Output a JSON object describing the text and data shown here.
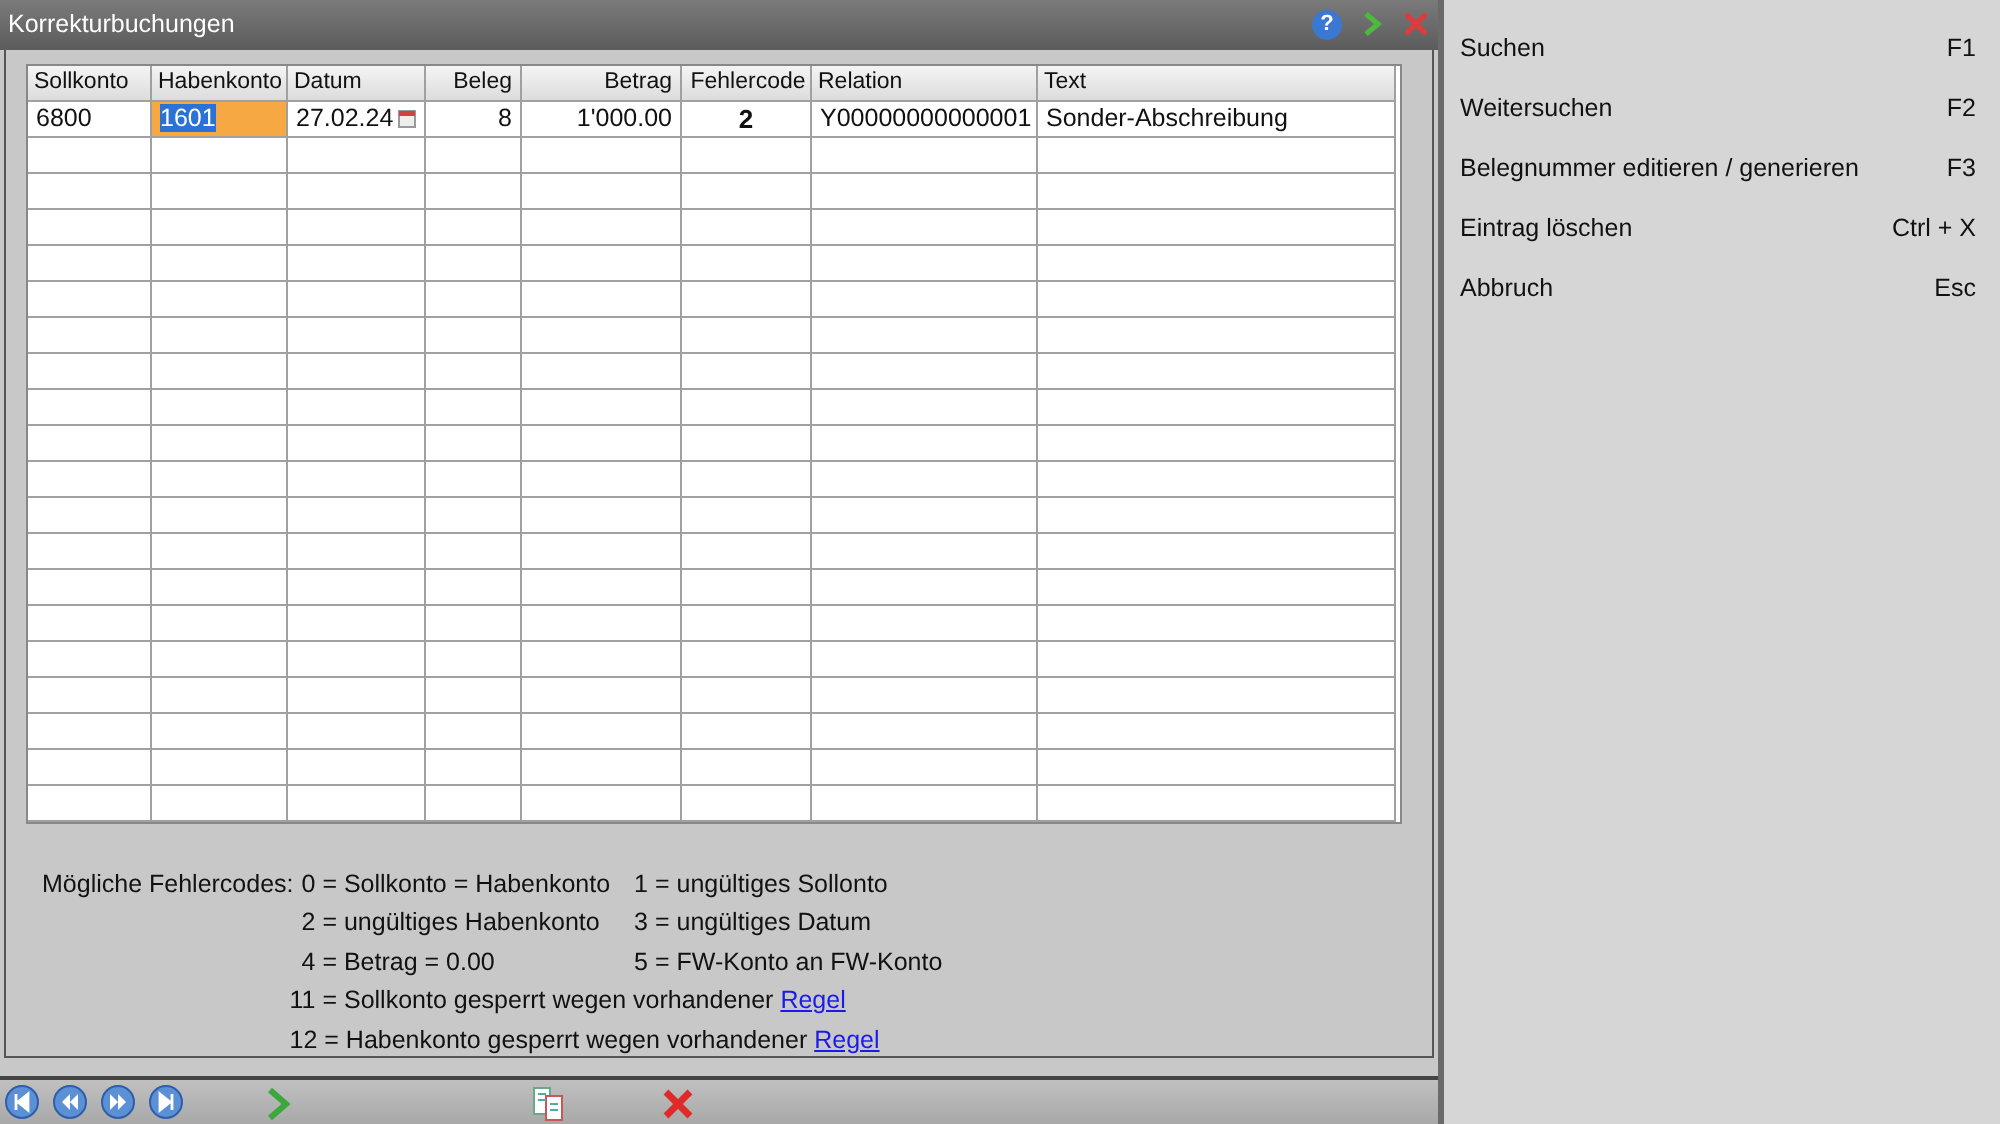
{
  "window": {
    "title": "Korrekturbuchungen",
    "help_glyph": "?"
  },
  "table": {
    "columns": [
      {
        "label": "Sollkonto",
        "kind": "text"
      },
      {
        "label": "Habenkonto",
        "kind": "text"
      },
      {
        "label": "Datum",
        "kind": "date"
      },
      {
        "label": "Beleg",
        "kind": "number"
      },
      {
        "label": "Betrag",
        "kind": "number"
      },
      {
        "label": "Fehlercode",
        "kind": "code"
      },
      {
        "label": "Relation",
        "kind": "text"
      },
      {
        "label": "Text",
        "kind": "text"
      }
    ],
    "rows": [
      {
        "cells": [
          {
            "text": "6800",
            "selected": false
          },
          {
            "text": "1601",
            "selected": true
          },
          {
            "text": "27.02.24",
            "selected": false
          },
          {
            "text": "8",
            "selected": false
          },
          {
            "text": "1'000.00",
            "selected": false
          },
          {
            "text": "2",
            "selected": false
          },
          {
            "text": "Y00000000000001",
            "selected": false
          },
          {
            "text": "Sonder-Abschreibung",
            "selected": false
          }
        ]
      }
    ]
  },
  "legend": {
    "label": "Mögliche Fehlercodes:",
    "pairs": [
      [
        "0 = Sollkonto = Habenkonto",
        "1 = ungültiges Sollonto"
      ],
      [
        "2 = ungültiges Habenkonto",
        "3 = ungültiges Datum"
      ],
      [
        "4 = Betrag = 0.00",
        "5 = FW-Konto an FW-Konto"
      ]
    ],
    "rules": [
      {
        "text": "11 = Sollkonto gesperrt wegen vorhandener",
        "link": "Regel"
      },
      {
        "text": "12 = Habenkonto gesperrt wegen vorhandener",
        "link": "Regel"
      }
    ]
  },
  "shortcuts": [
    {
      "label": "Suchen",
      "key": "F1"
    },
    {
      "label": "Weitersuchen",
      "key": "F2"
    },
    {
      "label": "Belegnummer editieren / generieren",
      "key": "F3"
    },
    {
      "label": "Eintrag löschen",
      "key": "Ctrl + X"
    },
    {
      "label": "Abbruch",
      "key": "Esc"
    }
  ]
}
